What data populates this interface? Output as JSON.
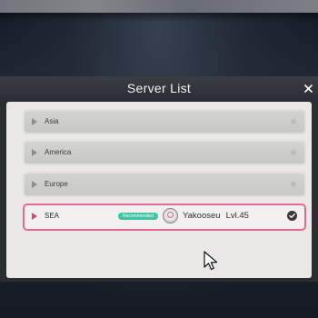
{
  "dialog": {
    "title": "Server List",
    "close_icon": "close-icon"
  },
  "servers": [
    {
      "name": "Asia",
      "selected": false
    },
    {
      "name": "America",
      "selected": false
    },
    {
      "name": "Europe",
      "selected": false
    },
    {
      "name": "SEA",
      "selected": true,
      "badge": "Recommended",
      "player_name": "Yakooseu",
      "player_level": "Lvl.45"
    }
  ],
  "colors": {
    "selected_border": "#e26a96",
    "badge": "#3fc5a5",
    "panel": "#e9e8e6",
    "header": "#2a2d33"
  }
}
